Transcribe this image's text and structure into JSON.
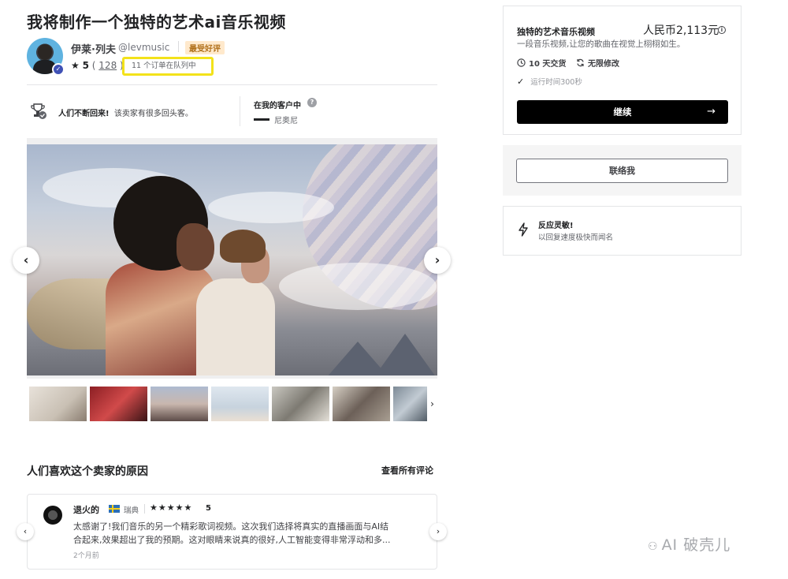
{
  "gig": {
    "title": "我将制作一个独特的艺术ai音乐视频"
  },
  "seller": {
    "name": "伊莱·列夫",
    "handle": "@levmusic",
    "badge": "最受好评",
    "rating": "5",
    "review_count": "128",
    "queue": "11 个订单在队列中"
  },
  "highlights": {
    "returning_bold": "人们不断回来!",
    "returning_text": "该卖家有很多回头客。",
    "clients_title": "在我的客户中",
    "client_name": "尼奥尼"
  },
  "reviews": {
    "section_title": "人们喜欢这个卖家的原因",
    "see_all": "查看所有评论",
    "item": {
      "name": "退火的",
      "country": "瑞典",
      "stars": "★★★★★",
      "score": "5",
      "line1": "太感谢了!我们音乐的另一个精彩歌词视频。这次我们选择将真实的直播画面与AI结",
      "line2": "合起来,效果超出了我的预期。这对眼睛来说真的很好,人工智能变得非常浮动和多...",
      "time": "2个月前"
    }
  },
  "package": {
    "title": "独特的艺术音乐视频",
    "price": "人民币2,113元",
    "description": "一段音乐视频,让您的歌曲在视觉上栩栩如生。",
    "delivery": "10 天交货",
    "revisions": "无限修改",
    "runtime": "运行时间300秒",
    "continue_label": "继续",
    "continue_arrow": "→"
  },
  "contact": {
    "label": "联络我"
  },
  "response": {
    "title": "反应灵敏!",
    "subtitle": "以回复速度极快而闻名"
  },
  "watermark": {
    "text": "AI 破壳儿"
  },
  "icons": {
    "prev": "‹",
    "next": "›"
  },
  "colors": {
    "queue_highlight": "#f3e21a",
    "badge_bg": "#ffe9cc",
    "continue_bg": "#000000"
  }
}
